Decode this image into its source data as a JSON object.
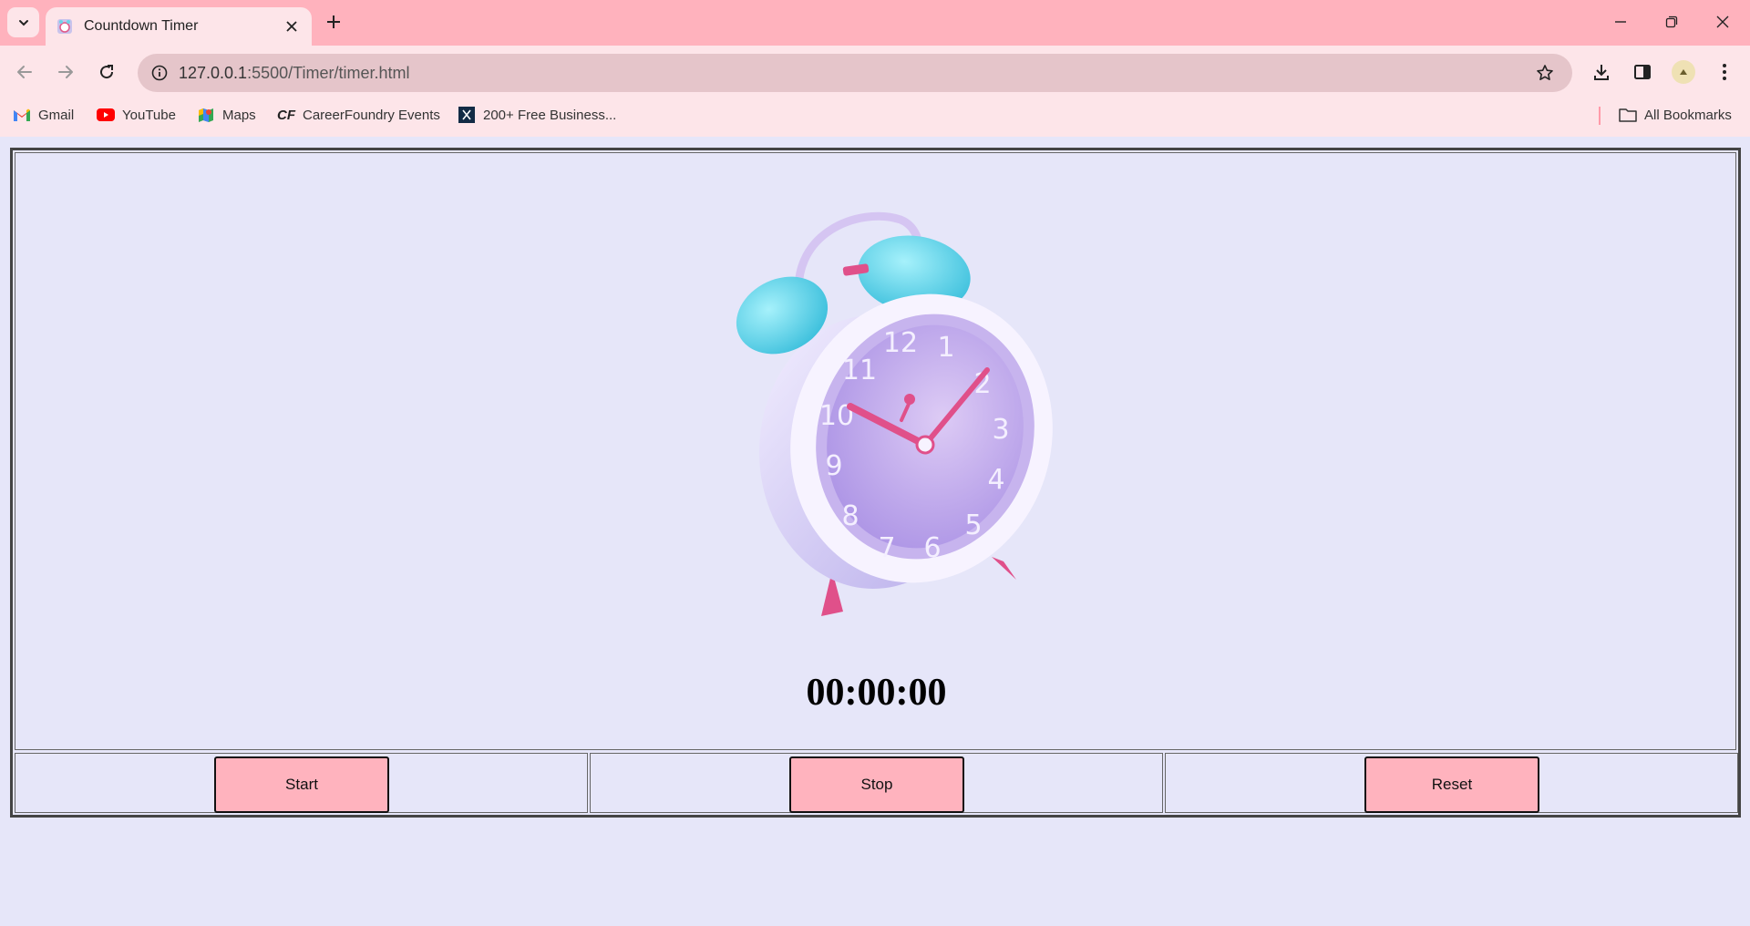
{
  "browser": {
    "tab": {
      "title": "Countdown Timer"
    },
    "url": {
      "host": "127.0.0.1",
      "rest": ":5500/Timer/timer.html"
    },
    "bookmarks": [
      {
        "label": "Gmail",
        "icon": "gmail-icon"
      },
      {
        "label": "YouTube",
        "icon": "youtube-icon"
      },
      {
        "label": "Maps",
        "icon": "maps-icon"
      },
      {
        "label": "CareerFoundry Events",
        "icon": "careerfoundry-icon"
      },
      {
        "label": "200+ Free Business...",
        "icon": "bookmark-x-icon"
      }
    ],
    "all_bookmarks": "All Bookmarks"
  },
  "timer": {
    "display": "00:00:00",
    "start_label": "Start",
    "stop_label": "Stop",
    "reset_label": "Reset"
  },
  "colors": {
    "tabstrip": "#ffb2bd",
    "toolbar": "#fde5e9",
    "page_background": "#e6e6f9",
    "button": "#ffb3be"
  }
}
